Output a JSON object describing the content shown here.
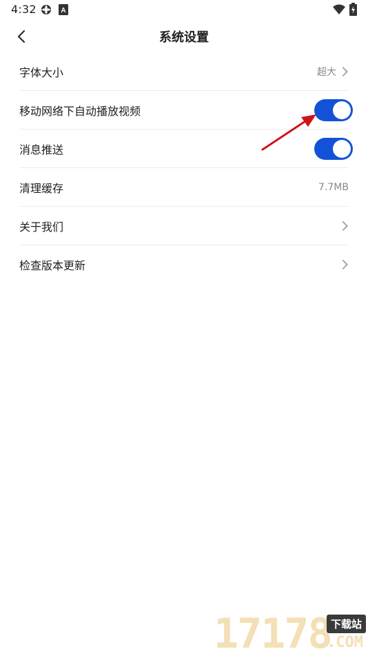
{
  "status_bar": {
    "time": "4:32",
    "icons": [
      "settings-gear-icon",
      "sim-a-icon",
      "wifi-icon",
      "battery-charging-icon"
    ]
  },
  "nav": {
    "title": "系统设置",
    "back_icon": "chevron-left-icon"
  },
  "settings": {
    "font_size": {
      "label": "字体大小",
      "value": "超大"
    },
    "autoplay_mobile": {
      "label": "移动网络下自动播放视频",
      "enabled": true
    },
    "push_notify": {
      "label": "消息推送",
      "enabled": true
    },
    "clear_cache": {
      "label": "清理缓存",
      "value": "7.7MB"
    },
    "about": {
      "label": "关于我们"
    },
    "check_update": {
      "label": "检查版本更新"
    }
  },
  "colors": {
    "toggle_on": "#1352d6",
    "annotation_arrow": "#d0121b",
    "watermark": "#f4dfb6"
  },
  "watermark": {
    "digits": "17178",
    "badge": "下载站",
    "suffix": ".COM"
  }
}
